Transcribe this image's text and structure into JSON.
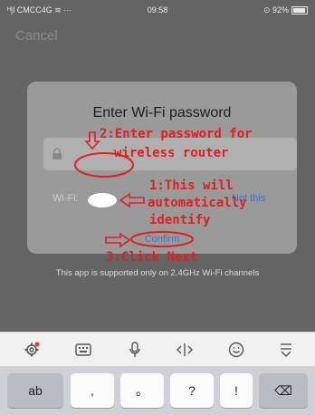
{
  "status_bar": {
    "carrier": "ᴴ|l CMCC4G ≋ ···",
    "time": "09:58",
    "battery": "⊙ 92%"
  },
  "cancel_label": "Cancel",
  "dialog": {
    "title": "Enter Wi-Fi password",
    "wifi_label": "Wi-Fi:",
    "not_this_label": "Not this",
    "confirm_label": "Confirm"
  },
  "footer_note": "This app is supported only on 2.4GHz Wi-Fi channels",
  "annotations": {
    "step2_line1": "2:Enter password for",
    "step2_line2": "wireless router",
    "step1_line1": "1:This will",
    "step1_line2": "automatically",
    "step1_line3": "identify",
    "step3": "3:Click Next",
    "color": "#e02020"
  },
  "keyboard": {
    "tools": [
      "settings-icon",
      "keyboard-icon",
      "microphone-icon",
      "cursor-icon",
      "emoji-icon",
      "collapse-icon"
    ],
    "keys": [
      "ab",
      ",",
      "。",
      "?",
      "!",
      "⌫"
    ]
  }
}
